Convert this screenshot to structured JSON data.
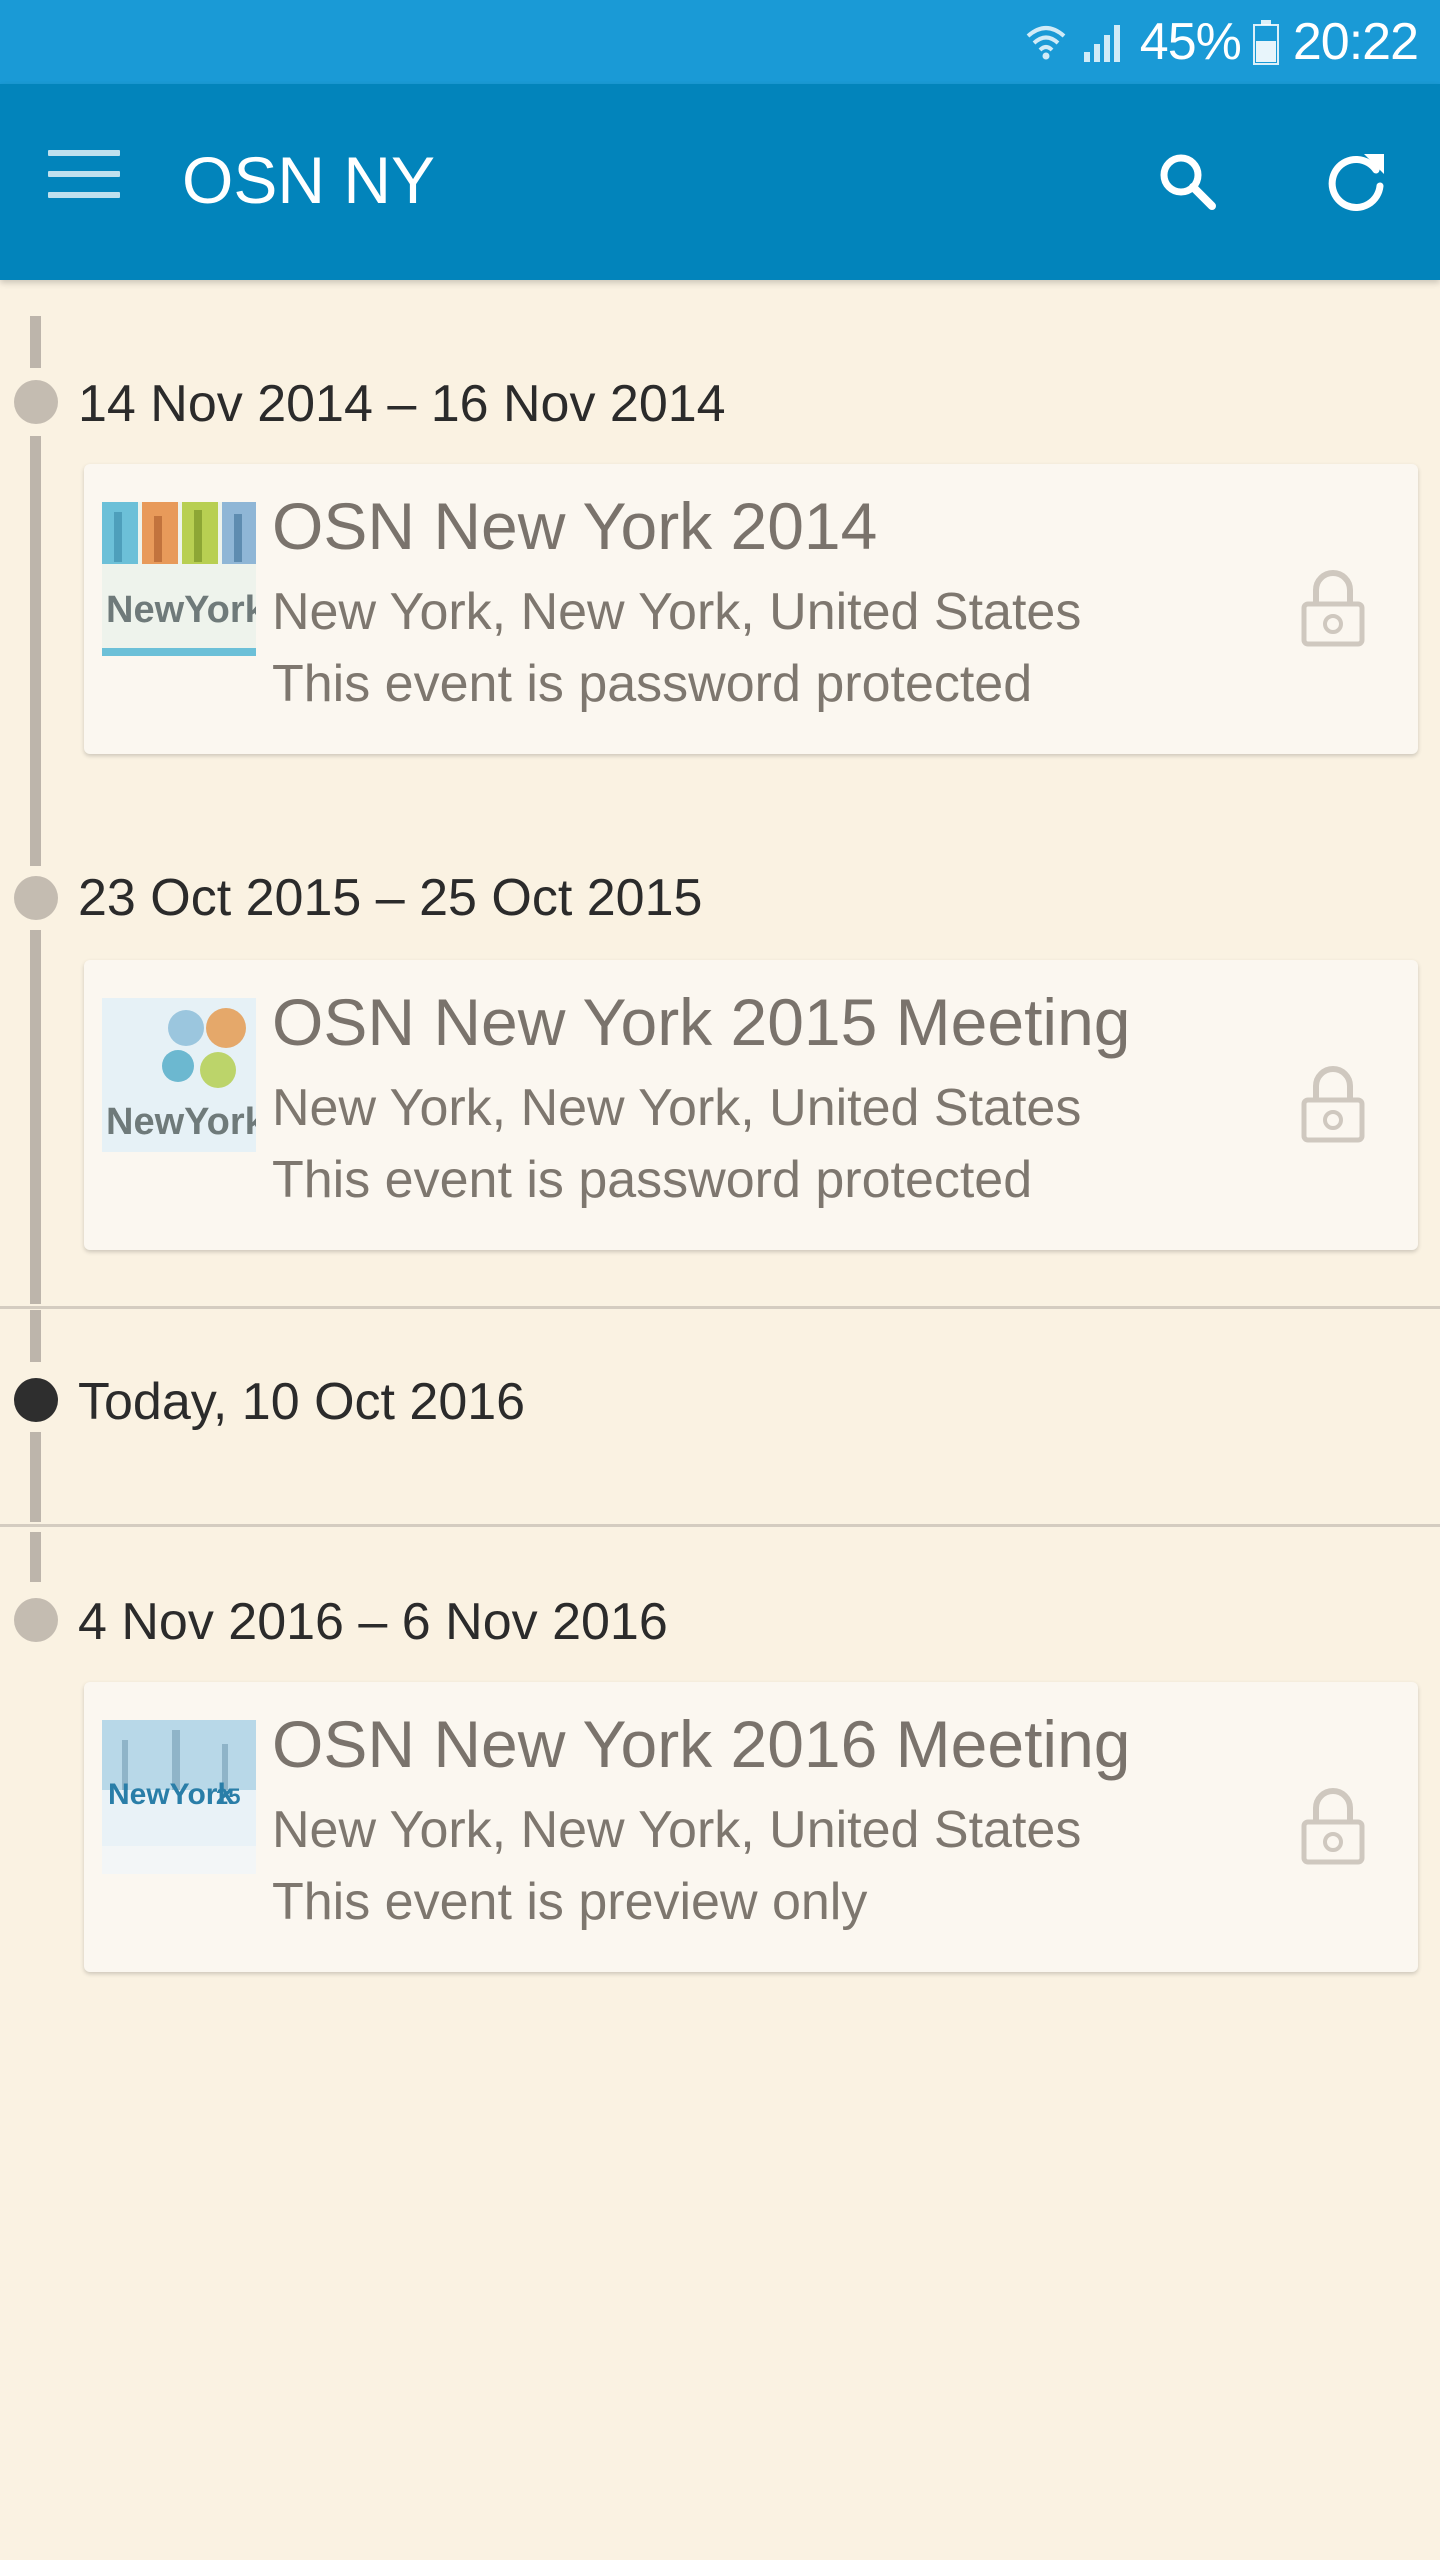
{
  "status_bar": {
    "battery_percent": "45%",
    "time": "20:22",
    "icons": [
      "wifi-icon",
      "signal-icon",
      "battery-icon"
    ]
  },
  "app_bar": {
    "title": "OSN NY",
    "icons": [
      "menu-icon",
      "search-icon",
      "refresh-icon"
    ]
  },
  "colors": {
    "status_bar": "#1a9ad6",
    "app_bar": "#0284bb",
    "background": "#faf2e2",
    "timeline": "#bdb5ab",
    "today_dot": "#2e2e2e"
  },
  "timeline": [
    {
      "date_range": "14 Nov 2014 – 16 Nov 2014",
      "event": {
        "title": "OSN New York 2014",
        "location": "New York, New York, United States",
        "status": "This event is password protected",
        "logo_text": "NewYork",
        "icon": "lock-icon"
      }
    },
    {
      "date_range": "23 Oct 2015 – 25 Oct 2015",
      "event": {
        "title": "OSN New York 2015 Meeting",
        "location": "New York, New York, United States",
        "status": "This event is password protected",
        "logo_text": "NewYork",
        "icon": "lock-icon"
      }
    },
    {
      "today_label": "Today, 10 Oct 2016"
    },
    {
      "date_range": "4 Nov 2016 – 6 Nov 2016",
      "event": {
        "title": "OSN New York 2016 Meeting",
        "location": "New York, New York, United States",
        "status": "This event is preview only",
        "logo_text": "NewYork",
        "logo_badge": "25",
        "icon": "lock-icon"
      }
    }
  ]
}
